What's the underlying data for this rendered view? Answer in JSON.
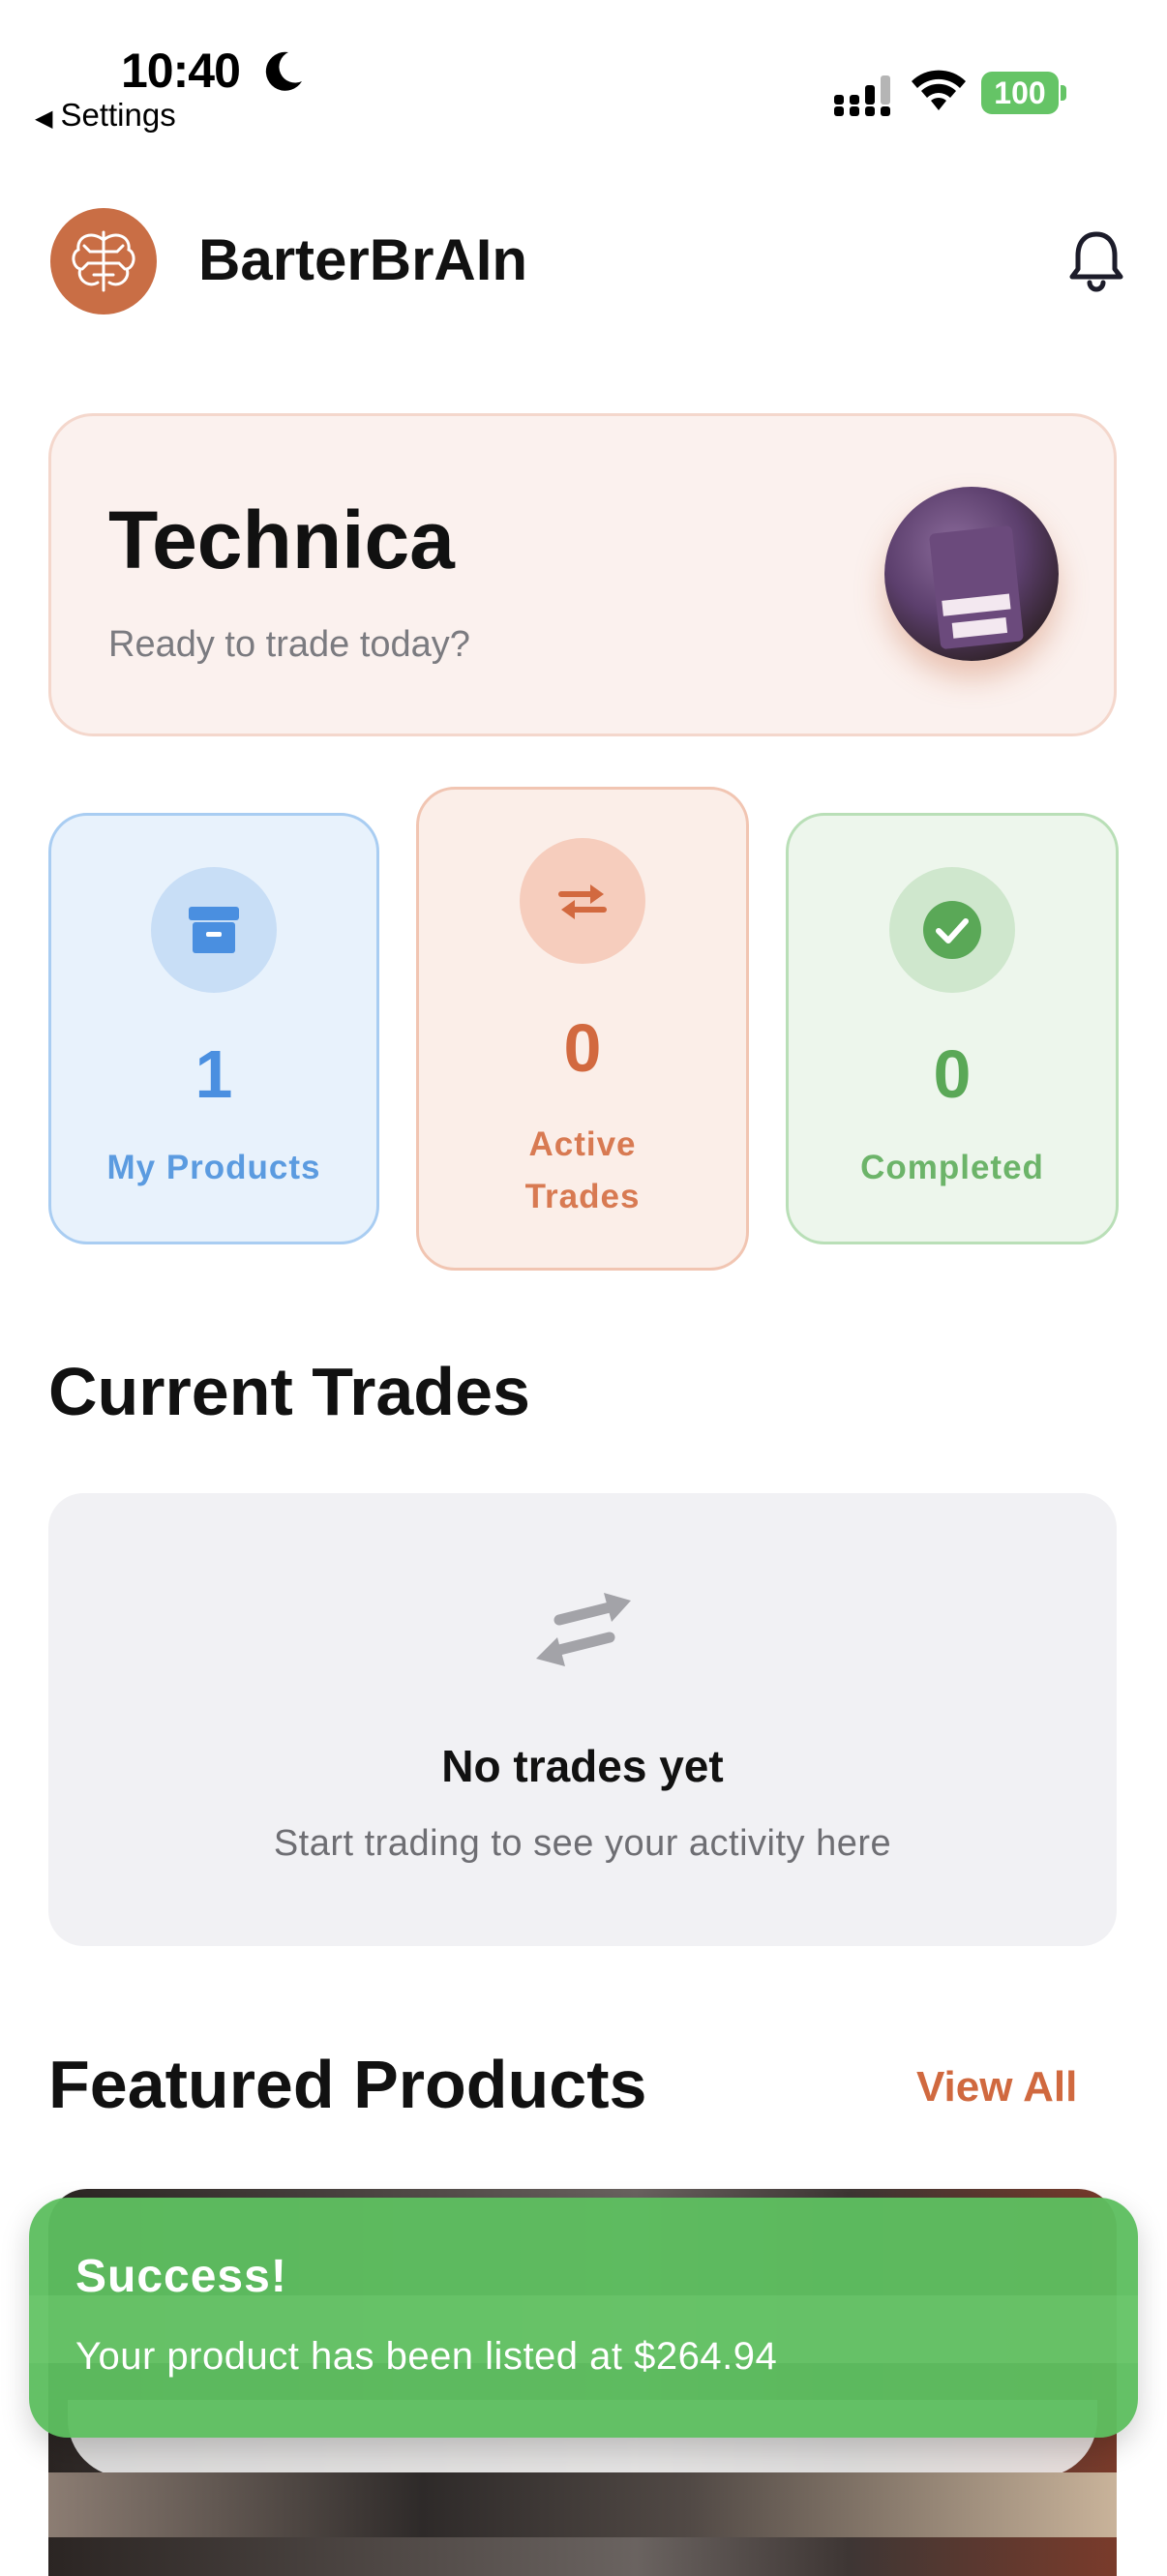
{
  "status_bar": {
    "time": "10:40",
    "back_label": "Settings",
    "battery": "100",
    "moon_icon": "moon-icon",
    "signal_icon": "cellular-signal-icon",
    "wifi_icon": "wifi-icon"
  },
  "header": {
    "app_name": "BarterBrAIn",
    "logo_icon": "brain-circuit-icon",
    "notification_icon": "bell-icon"
  },
  "welcome": {
    "name": "Technica",
    "subtitle": "Ready to trade today?"
  },
  "stats": [
    {
      "value": "1",
      "label": "My Products",
      "icon": "archive-box-icon",
      "color": "#4a8fe0"
    },
    {
      "value": "0",
      "label_line1": "Active",
      "label_line2": "Trades",
      "icon": "swap-arrows-icon",
      "color": "#d2693f"
    },
    {
      "value": "0",
      "label": "Completed",
      "icon": "check-circle-icon",
      "color": "#5aa857"
    }
  ],
  "current_trades": {
    "title": "Current Trades",
    "empty_title": "No trades yet",
    "empty_subtitle": "Start trading to see your activity here",
    "empty_icon": "swap-arrows-icon"
  },
  "featured": {
    "title": "Featured Products",
    "view_all": "View All"
  },
  "toast": {
    "title": "Success!",
    "message": "Your product has been listed at $264.94",
    "color": "#5ebe60"
  },
  "colors": {
    "accent": "#d0693f",
    "blue": "#4a8fe0",
    "green": "#5aa857"
  }
}
